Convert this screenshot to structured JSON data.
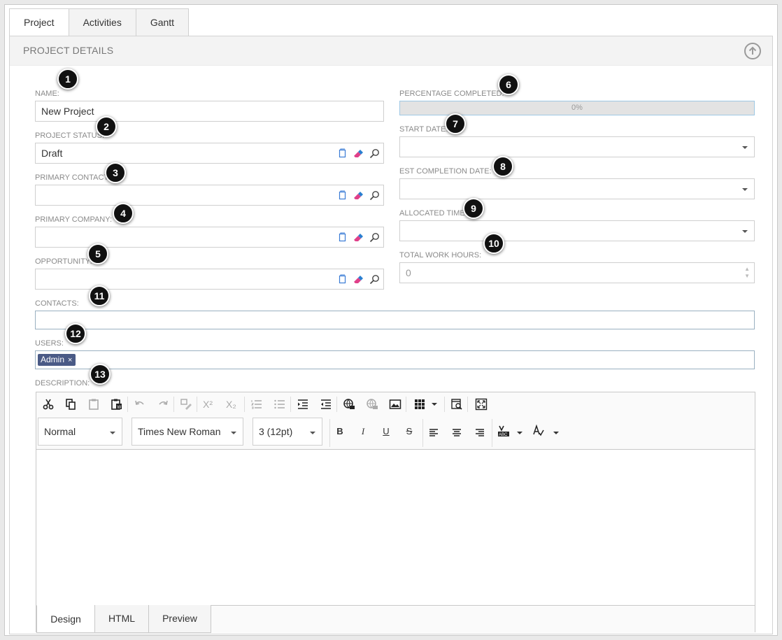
{
  "tabs": [
    "Project",
    "Activities",
    "Gantt"
  ],
  "section": {
    "title": "PROJECT DETAILS"
  },
  "fields": {
    "name": {
      "label": "NAME:",
      "value": "New Project"
    },
    "project_status": {
      "label": "PROJECT STATUS:",
      "value": "Draft"
    },
    "primary_contact": {
      "label": "PRIMARY CONTACT:",
      "value": ""
    },
    "primary_company": {
      "label": "PRIMARY COMPANY:",
      "value": ""
    },
    "opportunity": {
      "label": "OPPORTUNITY:",
      "value": ""
    },
    "percentage_completed": {
      "label": "PERCENTAGE COMPLETED:",
      "value": "0%",
      "fraction": 0
    },
    "start_date": {
      "label": "START DATE:",
      "value": ""
    },
    "est_completion_date": {
      "label": "EST COMPLETION DATE:",
      "value": ""
    },
    "allocated_time": {
      "label": "ALLOCATED TIME:",
      "value": ""
    },
    "total_work_hours": {
      "label": "TOTAL WORK HOURS:",
      "value": "0"
    },
    "contacts": {
      "label": "CONTACTS:"
    },
    "users": {
      "label": "USERS:",
      "chips": [
        "Admin"
      ],
      "chip_remove": "×"
    },
    "description": {
      "label": "DESCRIPTION:"
    }
  },
  "editor": {
    "format": "Normal",
    "font": "Times New Roman",
    "size": "3 (12pt)",
    "bold": "B",
    "italic": "I",
    "underline": "U",
    "strike": "S",
    "superscript": "X²",
    "subscript": "X₂",
    "modes": [
      "Design",
      "HTML",
      "Preview"
    ]
  },
  "markers": [
    "1",
    "2",
    "3",
    "4",
    "5",
    "6",
    "7",
    "8",
    "9",
    "10",
    "11",
    "12",
    "13"
  ],
  "colors": {
    "accent": "#4a5a86",
    "marker": "#111111",
    "progress_border": "#9ec8e4"
  }
}
